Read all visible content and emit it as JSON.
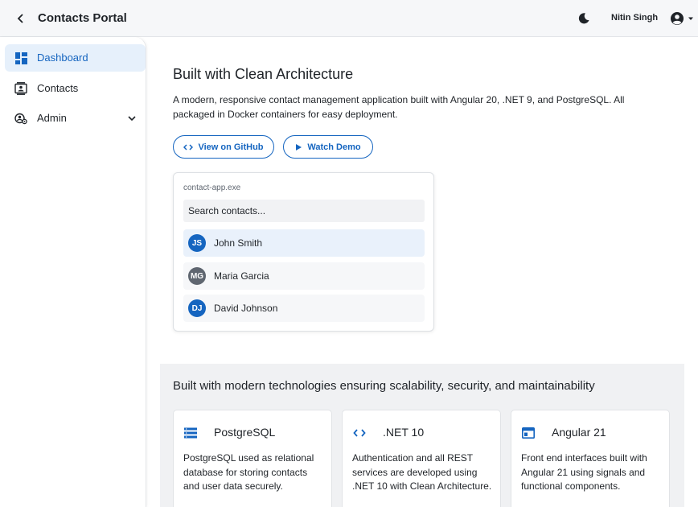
{
  "header": {
    "title": "Contacts Portal",
    "back_icon": "chevron-left-icon",
    "theme_icon": "moon-icon",
    "user_name": "Nitin Singh",
    "account_icon": "account-circle-icon"
  },
  "sidebar": {
    "items": [
      {
        "label": "Dashboard",
        "icon": "dashboard-icon",
        "active": true
      },
      {
        "label": "Contacts",
        "icon": "contact-card-icon",
        "active": false
      },
      {
        "label": "Admin",
        "icon": "admin-settings-icon",
        "active": false,
        "expandable": true
      }
    ]
  },
  "hero": {
    "title": "Built with Clean Architecture",
    "description": "A modern, responsive contact management application built with Angular 20, .NET 9, and PostgreSQL. All packaged in Docker containers for easy deployment.",
    "github_label": "View on GitHub",
    "demo_label": "Watch Demo"
  },
  "demo_app": {
    "window_title": "contact-app.exe",
    "search_placeholder": "Search contacts...",
    "contacts": [
      {
        "initials": "JS",
        "name": "John Smith",
        "color": "#1565c0",
        "selected": true
      },
      {
        "initials": "MG",
        "name": "Maria Garcia",
        "color": "#5f6670",
        "selected": false
      },
      {
        "initials": "DJ",
        "name": "David Johnson",
        "color": "#1565c0",
        "selected": false
      }
    ]
  },
  "tech": {
    "title": "Built with modern technologies ensuring scalability, security, and maintainability",
    "cards": [
      {
        "icon": "database-list-icon",
        "name": "PostgreSQL",
        "description": "PostgreSQL used as relational database for storing contacts and user data securely."
      },
      {
        "icon": "code-brackets-icon",
        "name": ".NET 10",
        "description": "Authentication and all REST services are developed using .NET 10 with Clean Architecture."
      },
      {
        "icon": "browser-window-icon",
        "name": "Angular 21",
        "description": "Front end interfaces built with Angular 21 using signals and functional components."
      }
    ]
  },
  "colors": {
    "accent": "#1565c0",
    "active_bg": "#e6f0fb",
    "section_bg": "#f0f1f3"
  }
}
